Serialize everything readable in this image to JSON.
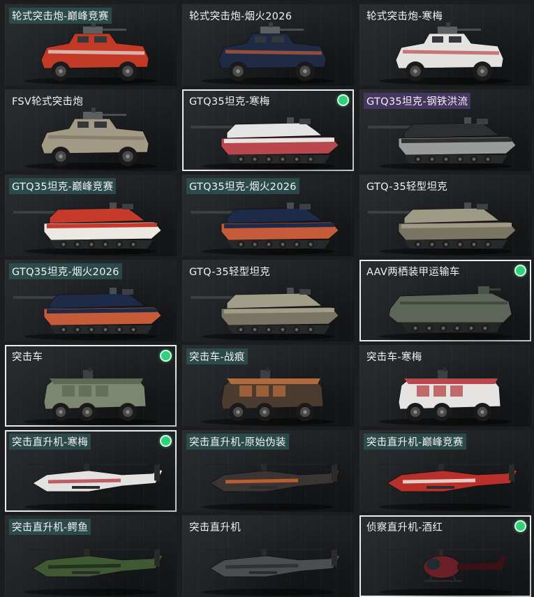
{
  "cards": [
    {
      "label": "轮式突击炮-巅峰竞赛",
      "vehicle": "wheeled-assault-gun",
      "body_color": "#c23a26",
      "accent_color": "#e8e4de",
      "equipped": false,
      "selected": false,
      "label_style": "teal"
    },
    {
      "label": "轮式突击炮-烟火2026",
      "vehicle": "wheeled-assault-gun",
      "body_color": "#1f2b45",
      "accent_color": "#c65b3a",
      "equipped": false,
      "selected": false,
      "label_style": "none"
    },
    {
      "label": "轮式突击炮-寒梅",
      "vehicle": "wheeled-assault-gun",
      "body_color": "#e4e2de",
      "accent_color": "#b8484e",
      "equipped": false,
      "selected": false,
      "label_style": "none"
    },
    {
      "label": "FSV轮式突击炮",
      "vehicle": "wheeled-assault-gun",
      "body_color": "#a39a86",
      "accent_color": "#7c7566",
      "equipped": false,
      "selected": false,
      "label_style": "none"
    },
    {
      "label": "GTQ35坦克-寒梅",
      "vehicle": "tank",
      "body_color": "#e6e4e2",
      "accent_color": "#b8484e",
      "equipped": true,
      "selected": true,
      "label_style": "none"
    },
    {
      "label": "GTQ35坦克-钢铁洪流",
      "vehicle": "tank",
      "body_color": "#2d2f31",
      "accent_color": "#9a9c9a",
      "equipped": false,
      "selected": false,
      "label_style": "purple"
    },
    {
      "label": "GTQ35坦克-巅峰竞赛",
      "vehicle": "tank",
      "body_color": "#c63a2c",
      "accent_color": "#ece8e2",
      "equipped": false,
      "selected": false,
      "label_style": "teal"
    },
    {
      "label": "GTQ35坦克-烟火2026",
      "vehicle": "tank",
      "body_color": "#1d2a48",
      "accent_color": "#c65b3a",
      "equipped": false,
      "selected": false,
      "label_style": "teal"
    },
    {
      "label": "GTQ-35轻型坦克",
      "vehicle": "tank",
      "body_color": "#9f9a86",
      "accent_color": "#7a7462",
      "equipped": false,
      "selected": false,
      "label_style": "none"
    },
    {
      "label": "GTQ35坦克-烟火2026",
      "vehicle": "tank",
      "body_color": "#1d2a48",
      "accent_color": "#c65b3a",
      "equipped": false,
      "selected": false,
      "label_style": "teal"
    },
    {
      "label": "GTQ-35轻型坦克",
      "vehicle": "tank",
      "body_color": "#a29d88",
      "accent_color": "#7a7462",
      "equipped": false,
      "selected": false,
      "label_style": "none"
    },
    {
      "label": "AAV两栖装甲运输车",
      "vehicle": "amphibious",
      "body_color": "#5e6659",
      "accent_color": "#434a40",
      "equipped": true,
      "selected": true,
      "label_style": "none"
    },
    {
      "label": "突击车",
      "vehicle": "assault-vehicle",
      "body_color": "#7b8770",
      "accent_color": "#5e6a55",
      "equipped": true,
      "selected": true,
      "label_style": "none"
    },
    {
      "label": "突击车-战痕",
      "vehicle": "assault-vehicle",
      "body_color": "#4b3b2e",
      "accent_color": "#b06a3c",
      "equipped": false,
      "selected": false,
      "label_style": "teal"
    },
    {
      "label": "突击车-寒梅",
      "vehicle": "assault-vehicle",
      "body_color": "#e6e4e2",
      "accent_color": "#b8484e",
      "equipped": false,
      "selected": false,
      "label_style": "none"
    },
    {
      "label": "突击直升机-寒梅",
      "vehicle": "helicopter",
      "body_color": "#e4e2e0",
      "accent_color": "#b8484e",
      "equipped": true,
      "selected": true,
      "label_style": "teal"
    },
    {
      "label": "突击直升机-原始伪装",
      "vehicle": "helicopter",
      "body_color": "#3a3533",
      "accent_color": "#d0642e",
      "equipped": false,
      "selected": false,
      "label_style": "teal"
    },
    {
      "label": "突击直升机-巅峰竞赛",
      "vehicle": "helicopter",
      "body_color": "#b9302a",
      "accent_color": "#ece8e2",
      "equipped": false,
      "selected": false,
      "label_style": "teal"
    },
    {
      "label": "突击直升机-鳄鱼",
      "vehicle": "helicopter",
      "body_color": "#3f5a32",
      "accent_color": "#1f2b1a",
      "equipped": false,
      "selected": false,
      "label_style": "teal"
    },
    {
      "label": "突击直升机",
      "vehicle": "helicopter",
      "body_color": "#4a4e50",
      "accent_color": "#2c2f31",
      "equipped": false,
      "selected": false,
      "label_style": "none"
    },
    {
      "label": "侦察直升机-酒红",
      "vehicle": "scout-helicopter",
      "body_color": "#6a1f26",
      "accent_color": "#3a1216",
      "equipped": true,
      "selected": true,
      "label_style": "none"
    }
  ]
}
